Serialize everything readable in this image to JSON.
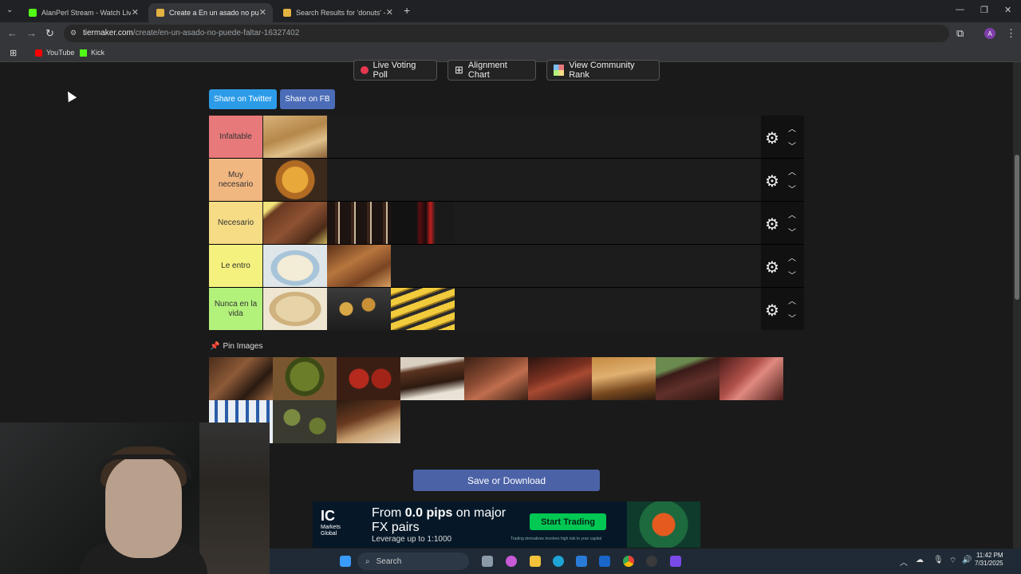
{
  "browser": {
    "tabs": [
      {
        "title": "AlanPerl Stream - Watch Live o",
        "favicon_color": "#53fc18"
      },
      {
        "title": "Create a En un asado no puede",
        "favicon_color": "#e3b341"
      },
      {
        "title": "Search Results for 'donuts' - Ti",
        "favicon_color": "#e3b341"
      }
    ],
    "url_host": "tiermaker.com",
    "url_path": "/create/en-un-asado-no-puede-faltar-16327402",
    "profile_initial": "A",
    "bookmarks": [
      {
        "label": "YouTube",
        "color": "#ff0000"
      },
      {
        "label": "Kick",
        "color": "#53fc18"
      }
    ]
  },
  "top_buttons": {
    "poll": "Live Voting Poll",
    "alignment": "Alignment Chart",
    "community": "View Community Rank"
  },
  "share": {
    "twitter": "Share on Twitter",
    "fb": "Share on FB"
  },
  "tiers": [
    {
      "label": "Infaltable",
      "color": "#e8797b",
      "items": 1
    },
    {
      "label": "Muy necesario",
      "color": "#f1b780",
      "items": 1
    },
    {
      "label": "Necesario",
      "color": "#f5dc85",
      "items": 3
    },
    {
      "label": "Le entro",
      "color": "#f5f17e",
      "items": 2
    },
    {
      "label": "Nunca en la vida",
      "color": "#b2f17a",
      "items": 3
    }
  ],
  "pin_images": {
    "label": "Pin Images"
  },
  "save_button": "Save or Download",
  "ad": {
    "brand": "IC",
    "brand_sub1": "Markets",
    "brand_sub2": "Global",
    "headline_pre": "From ",
    "headline_bold": "0.0 pips",
    "headline_post": " on major FX pairs",
    "subline": "Leverage up to 1:1000",
    "cta": "Start Trading",
    "disclaimer": "Trading derivatives involves high risk to your capital"
  },
  "taskbar": {
    "search_placeholder": "Search",
    "time": "11:42 PM",
    "date": "7/31/2025"
  }
}
